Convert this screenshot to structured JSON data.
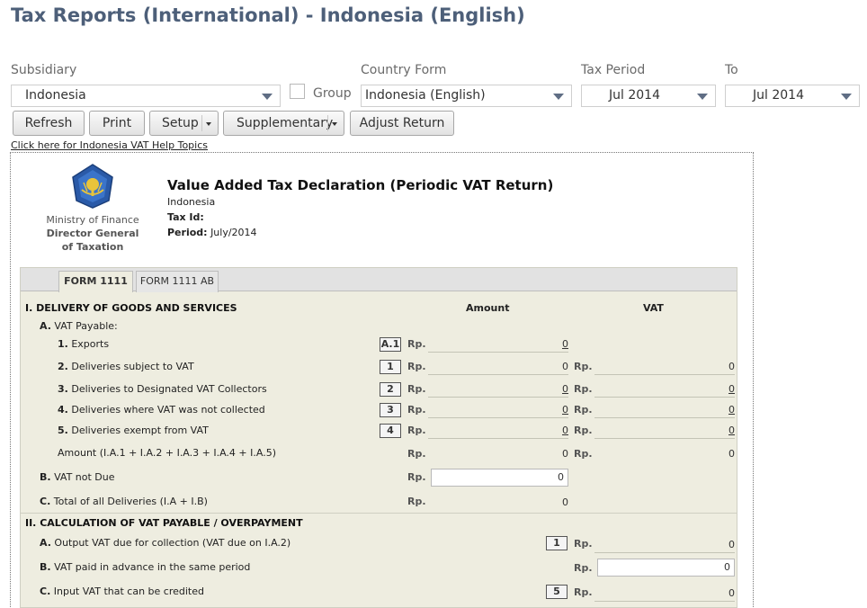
{
  "header": {
    "title": "Tax Reports (International) - Indonesia (English)"
  },
  "filters": {
    "subsidiary_label": "Subsidiary",
    "subsidiary_value": "Indonesia",
    "group_label": "Group",
    "country_form_label": "Country Form",
    "country_form_value": "Indonesia (English)",
    "tax_period_label": "Tax Period",
    "tax_period_value": "Jul 2014",
    "to_label": "To",
    "to_value": "Jul 2014"
  },
  "toolbar": {
    "refresh": "Refresh",
    "print": "Print",
    "setup": "Setup",
    "supplementary": "Supplementary",
    "adjust_return": "Adjust Return"
  },
  "help_link": "Click here for Indonesia VAT Help Topics",
  "logo": {
    "ministry": "Ministry of Finance",
    "director_general": "Director General",
    "of_taxation": "of Taxation"
  },
  "declaration": {
    "title": "Value Added Tax Declaration (Periodic VAT Return)",
    "country": "Indonesia",
    "tax_id_label": "Tax Id:",
    "period_label": "Period:",
    "period_value": "July/2014"
  },
  "tabs": [
    {
      "label": "FORM 1111",
      "active": true
    },
    {
      "label": "FORM 1111 AB",
      "active": false
    }
  ],
  "columns": {
    "amount": "Amount",
    "vat": "VAT"
  },
  "currency": "Rp.",
  "section1": {
    "title": "I. DELIVERY OF GOODS AND SERVICES",
    "a_label": "A.",
    "a_title": "VAT Payable:",
    "rows": [
      {
        "num": "1.",
        "label": "Exports",
        "box": "A.1",
        "amount": "0",
        "vat": ""
      },
      {
        "num": "2.",
        "label": "Deliveries subject to VAT",
        "box": "1",
        "amount": "0",
        "vat": "0"
      },
      {
        "num": "3.",
        "label": "Deliveries to Designated VAT Collectors",
        "box": "2",
        "amount": "0",
        "vat": "0"
      },
      {
        "num": "4.",
        "label": "Deliveries where VAT was not collected",
        "box": "3",
        "amount": "0",
        "vat": "0"
      },
      {
        "num": "5.",
        "label": "Deliveries exempt from VAT",
        "box": "4",
        "amount": "0",
        "vat": "0"
      }
    ],
    "sum_label": "Amount (I.A.1 + I.A.2 + I.A.3 + I.A.4 + I.A.5)",
    "sum_amount": "0",
    "sum_vat": "0",
    "b_label": "B.",
    "b_title": "VAT not Due",
    "b_value": "0",
    "c_label": "C.",
    "c_title": "Total of all Deliveries (I.A + I.B)",
    "c_value": "0"
  },
  "section2": {
    "title": "II. CALCULATION OF VAT PAYABLE / OVERPAYMENT",
    "a_label": "A.",
    "a_title": "Output VAT due for collection (VAT due on I.A.2)",
    "a_box": "1",
    "a_vat": "0",
    "b_label": "B.",
    "b_title": "VAT paid in advance in the same period",
    "b_value": "0",
    "c_label": "C.",
    "c_title": "Input VAT that can be credited",
    "c_box": "5",
    "c_vat": "0"
  }
}
